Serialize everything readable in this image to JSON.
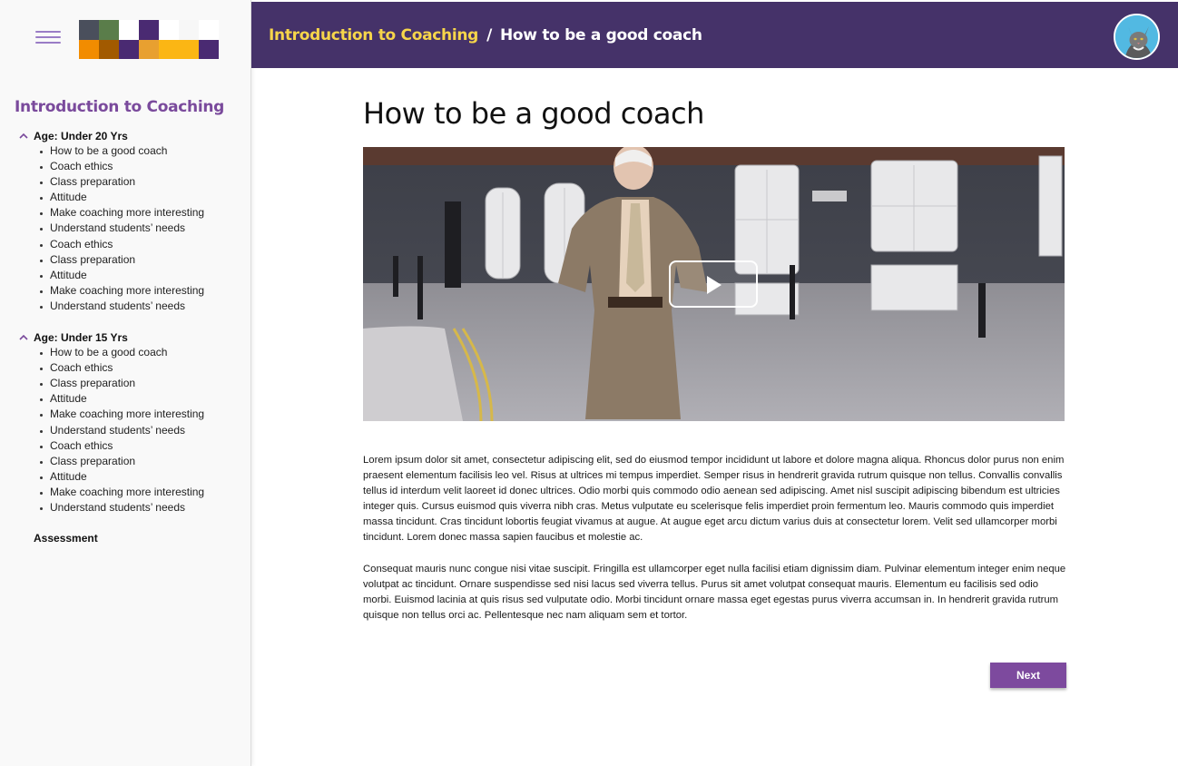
{
  "colors": {
    "header_bg": "#453269",
    "breadcrumb_link": "#f6d54a",
    "accent": "#7a4a9c",
    "button": "#7d4a9e",
    "logo_tiles": [
      "#4a4f5c",
      "#5a7d4a",
      "#ffffff",
      "#4a2a72",
      "#ffffff",
      "#f7f7f7",
      "#ffffff",
      "#f28c00",
      "#a25a00",
      "#4a2a72",
      "#e8a030",
      "#fbb614",
      "#fbb614",
      "#4a2a72"
    ]
  },
  "sidebar": {
    "course_title": "Introduction to Coaching",
    "sections": [
      {
        "title": "Age: Under 20 Yrs",
        "items": [
          "How to be a good coach",
          "Coach ethics",
          "Class preparation",
          "Attitude",
          "Make coaching more interesting",
          "Understand students’ needs",
          "Coach ethics",
          "Class preparation",
          "Attitude",
          "Make coaching more interesting",
          "Understand students’ needs"
        ]
      },
      {
        "title": "Age: Under 15 Yrs",
        "items": [
          "How to be a good coach",
          "Coach ethics",
          "Class preparation",
          "Attitude",
          "Make coaching more interesting",
          "Understand students’ needs",
          "Coach ethics",
          "Class preparation",
          "Attitude",
          "Make coaching more interesting",
          "Understand students’ needs"
        ]
      }
    ],
    "assessment": "Assessment"
  },
  "header": {
    "breadcrumb_link": "Introduction to Coaching",
    "breadcrumb_separator": "/",
    "breadcrumb_current": "How to be a good coach"
  },
  "main": {
    "title": "How to be a good coach",
    "paragraph1": "Lorem ipsum dolor sit amet, consectetur adipiscing elit, sed do eiusmod tempor incididunt ut labore et dolore magna aliqua. Rhoncus dolor purus non enim praesent elementum facilisis leo vel. Risus at ultrices mi tempus imperdiet. Semper risus in hendrerit gravida rutrum quisque non tellus. Convallis convallis tellus id interdum velit laoreet id donec ultrices. Odio morbi quis commodo odio aenean sed adipiscing. Amet nisl suscipit adipiscing bibendum est ultricies integer quis. Cursus euismod quis viverra nibh cras. Metus vulputate eu scelerisque felis imperdiet proin fermentum leo. Mauris commodo quis imperdiet massa tincidunt. Cras tincidunt lobortis feugiat vivamus at augue. At augue eget arcu dictum varius duis at consectetur lorem. Velit sed ullamcorper morbi tincidunt. Lorem donec massa sapien faucibus et molestie ac.",
    "paragraph2": "Consequat mauris nunc congue nisi vitae suscipit. Fringilla est ullamcorper eget nulla facilisi etiam dignissim diam. Pulvinar elementum integer enim neque volutpat ac tincidunt. Ornare suspendisse sed nisi lacus sed viverra tellus. Purus sit amet volutpat consequat mauris. Elementum eu facilisis sed odio morbi. Euismod lacinia at quis risus sed vulputate odio. Morbi tincidunt ornare massa eget egestas purus viverra accumsan in. In hendrerit gravida rutrum quisque non tellus orci ac. Pellentesque nec nam aliquam sem et tortor.",
    "next_label": "Next"
  }
}
